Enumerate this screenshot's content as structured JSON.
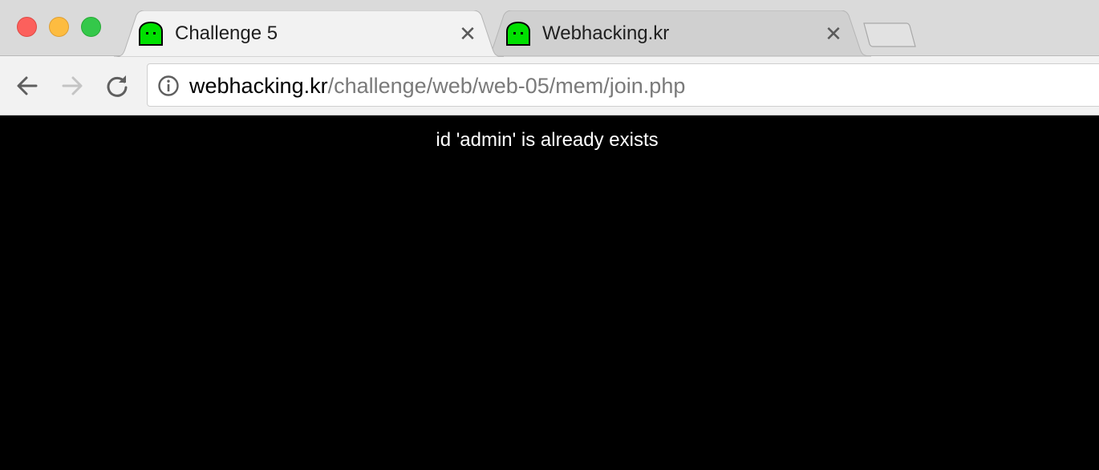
{
  "window": {
    "controls": [
      "close",
      "minimize",
      "maximize"
    ]
  },
  "tabs": [
    {
      "title": "Challenge 5",
      "active": true,
      "favicon": "green-ghost-icon"
    },
    {
      "title": "Webhacking.kr",
      "active": false,
      "favicon": "green-ghost-icon"
    }
  ],
  "toolbar": {
    "url_host": "webhacking.kr",
    "url_path": "/challenge/web/web-05/mem/join.php",
    "security_icon": "info-icon"
  },
  "page": {
    "message": "id 'admin' is already exists"
  },
  "colors": {
    "page_background": "#000000",
    "message_text": "#ffffff",
    "favicon_green": "#00e000"
  }
}
